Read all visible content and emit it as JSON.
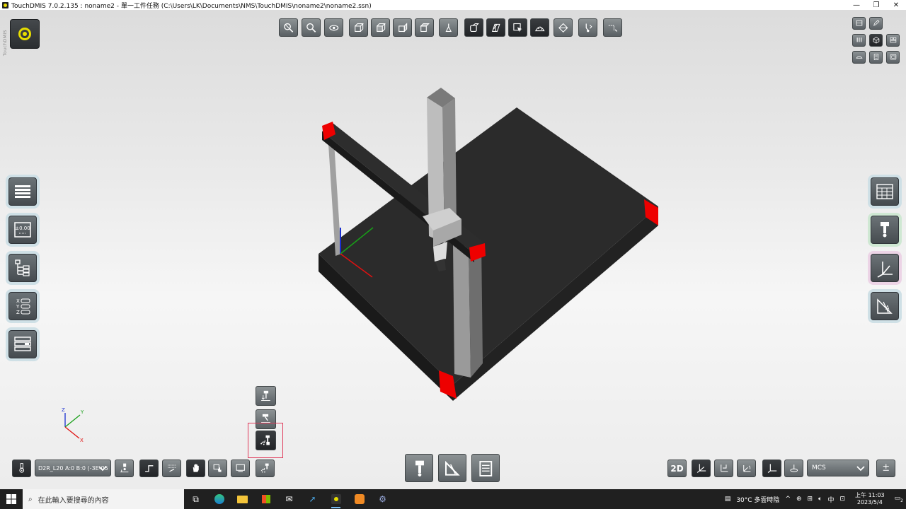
{
  "window": {
    "title": "TouchDMIS 7.0.2.135 :  noname2 - 單一工件任務    (C:\\Users\\LK\\Documents\\NMS\\TouchDMIS\\noname2\\noname2.ssn)",
    "controls": [
      "—",
      "❐",
      "✕"
    ]
  },
  "brand": {
    "vertical_text": "TouchDMIS"
  },
  "probe_selector": {
    "value": "D2R_L20 A:0 B:0 (-3E-05"
  },
  "coordinate_system": {
    "value": "MCS"
  },
  "view_mode": {
    "label": "2D"
  },
  "axis_triad": {
    "x": "X",
    "y": "Y",
    "z": "Z"
  },
  "taskbar": {
    "search_placeholder": "在此輸入要搜尋的內容",
    "weather": "30°C  多雲時陰",
    "ime": "中",
    "time": "上午 11:03",
    "date": "2023/5/4",
    "notification_count": "2"
  },
  "colors": {
    "accent_yellow": "#e7de00",
    "highlight_red": "#e03a5a",
    "button_gray": "#6c7377",
    "taskbar": "#202020"
  }
}
